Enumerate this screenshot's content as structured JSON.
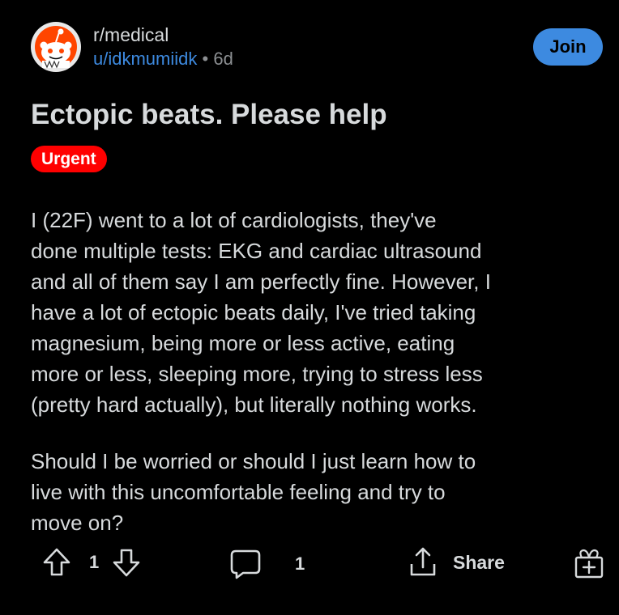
{
  "post": {
    "subreddit": "r/medical",
    "username": "u/idkmumiidk",
    "separator": "•",
    "age": "6d",
    "join_label": "Join",
    "title": "Ectopic beats. Please help",
    "flair": "Urgent",
    "body": [
      "I (22F) went to a lot of cardiologists, they've\ndone multiple tests: EKG and cardiac ultrasound\nand all of them say I am perfectly fine. However, I\nhave a lot of ectopic beats daily, I've tried taking\nmagnesium, being more or less active, eating\nmore or less, sleeping more, trying to stress less\n(pretty hard actually), but literally nothing works.",
      "Should I be worried or should I just learn how to\nlive with this uncomfortable feeling and try to\nmove on?"
    ]
  },
  "actions": {
    "vote_count": "1",
    "comment_count": "1",
    "share_label": "Share"
  },
  "icons": {
    "avatar": "reddit-snoo-avatar",
    "upvote": "upvote-arrow-icon",
    "downvote": "downvote-arrow-icon",
    "comment": "comment-bubble-icon",
    "share": "share-icon",
    "award": "award-gift-icon"
  },
  "colors": {
    "background": "#000000",
    "text": "#d7dadc",
    "username": "#3d8ae0",
    "join_button": "#3d8ae0",
    "flair": "#ff0000"
  }
}
